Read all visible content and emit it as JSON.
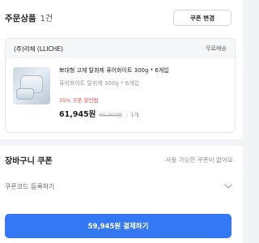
{
  "order": {
    "title": "주문상품",
    "count": "1건",
    "coupon_change_label": "쿠폰 변경"
  },
  "shop": {
    "name": "(주)리체 (LLICHE)",
    "shipping": "무료배송"
  },
  "product": {
    "name": "뽀대형 고체 탈취제 퓨어화이트 300g * 6개입",
    "option": "퓨어화이트 탈취제 300g * 6개입",
    "coupon_applied": "35% 쿠폰 할인됨",
    "price": "61,945원",
    "original_price": "95,300원",
    "separator": "|",
    "quantity": "1개",
    "image_icon": "product-thumbnail"
  },
  "cart_coupon": {
    "title": "장바구니 쿠폰",
    "status": "사용 가능한 쿠폰이 없어요.",
    "code_label": "쿠폰코드 등록하기",
    "chevron_icon": "chevron-down-icon"
  },
  "payment": {
    "button_label": "59,945원 결제하기"
  },
  "colors": {
    "accent": "#3478f6",
    "discount": "#ef4a4a",
    "background": "#f2f3f5"
  }
}
